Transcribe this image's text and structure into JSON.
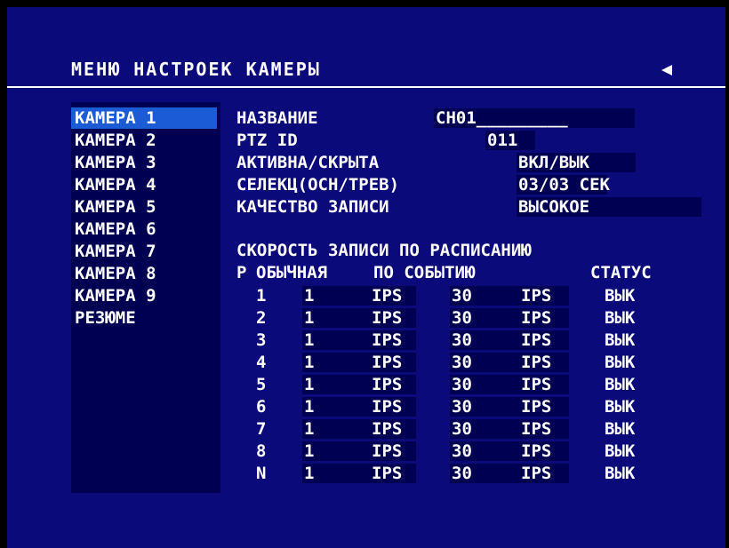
{
  "title": "МЕНЮ НАСТРОЕК КАМЕРЫ",
  "icons": {
    "back": "left-arrow-icon"
  },
  "colors": {
    "background": "#0a0a7a",
    "panel": "#000052",
    "selection": "#1b5bd6",
    "text": "#ffffff"
  },
  "cameras": [
    "КАМЕРА 1",
    "КАМЕРА 2",
    "КАМЕРА 3",
    "КАМЕРА 4",
    "КАМЕРА 5",
    "КАМЕРА 6",
    "КАМЕРА 7",
    "КАМЕРА 8",
    "КАМЕРА 9",
    "РЕЗЮМЕ"
  ],
  "selected_camera": "КАМЕРА 1",
  "settings": {
    "name_label": "НАЗВАНИЕ",
    "name_value": "CH01_________",
    "ptz_label": "PTZ ID",
    "ptz_value": "011",
    "active_label": "АКТИВНА/СКРЫТА",
    "active_value": "ВКЛ/ВЫК",
    "select_label": "СЕЛЕКЦ(ОСН/ТРЕВ)",
    "select_value": "03/03 СЕК",
    "quality_label": "КАЧЕСТВО ЗАПИСИ",
    "quality_value": "ВЫСОКОЕ"
  },
  "schedule": {
    "heading": "СКОРОСТЬ ЗАПИСИ ПО РАСПИСАНИЮ",
    "headers": {
      "p": "Р",
      "normal": "ОБЫЧНАЯ",
      "event": "ПО СОБЫТИЮ",
      "status": "СТАТУС"
    },
    "rows": [
      {
        "p": "1",
        "normal": "1",
        "normal_unit": "IPS",
        "event": "30",
        "event_unit": "IPS",
        "status": "ВЫК"
      },
      {
        "p": "2",
        "normal": "1",
        "normal_unit": "IPS",
        "event": "30",
        "event_unit": "IPS",
        "status": "ВЫК"
      },
      {
        "p": "3",
        "normal": "1",
        "normal_unit": "IPS",
        "event": "30",
        "event_unit": "IPS",
        "status": "ВЫК"
      },
      {
        "p": "4",
        "normal": "1",
        "normal_unit": "IPS",
        "event": "30",
        "event_unit": "IPS",
        "status": "ВЫК"
      },
      {
        "p": "5",
        "normal": "1",
        "normal_unit": "IPS",
        "event": "30",
        "event_unit": "IPS",
        "status": "ВЫК"
      },
      {
        "p": "6",
        "normal": "1",
        "normal_unit": "IPS",
        "event": "30",
        "event_unit": "IPS",
        "status": "ВЫК"
      },
      {
        "p": "7",
        "normal": "1",
        "normal_unit": "IPS",
        "event": "30",
        "event_unit": "IPS",
        "status": "ВЫК"
      },
      {
        "p": "8",
        "normal": "1",
        "normal_unit": "IPS",
        "event": "30",
        "event_unit": "IPS",
        "status": "ВЫК"
      },
      {
        "p": "N",
        "normal": "1",
        "normal_unit": "IPS",
        "event": "30",
        "event_unit": "IPS",
        "status": "ВЫК"
      }
    ]
  }
}
